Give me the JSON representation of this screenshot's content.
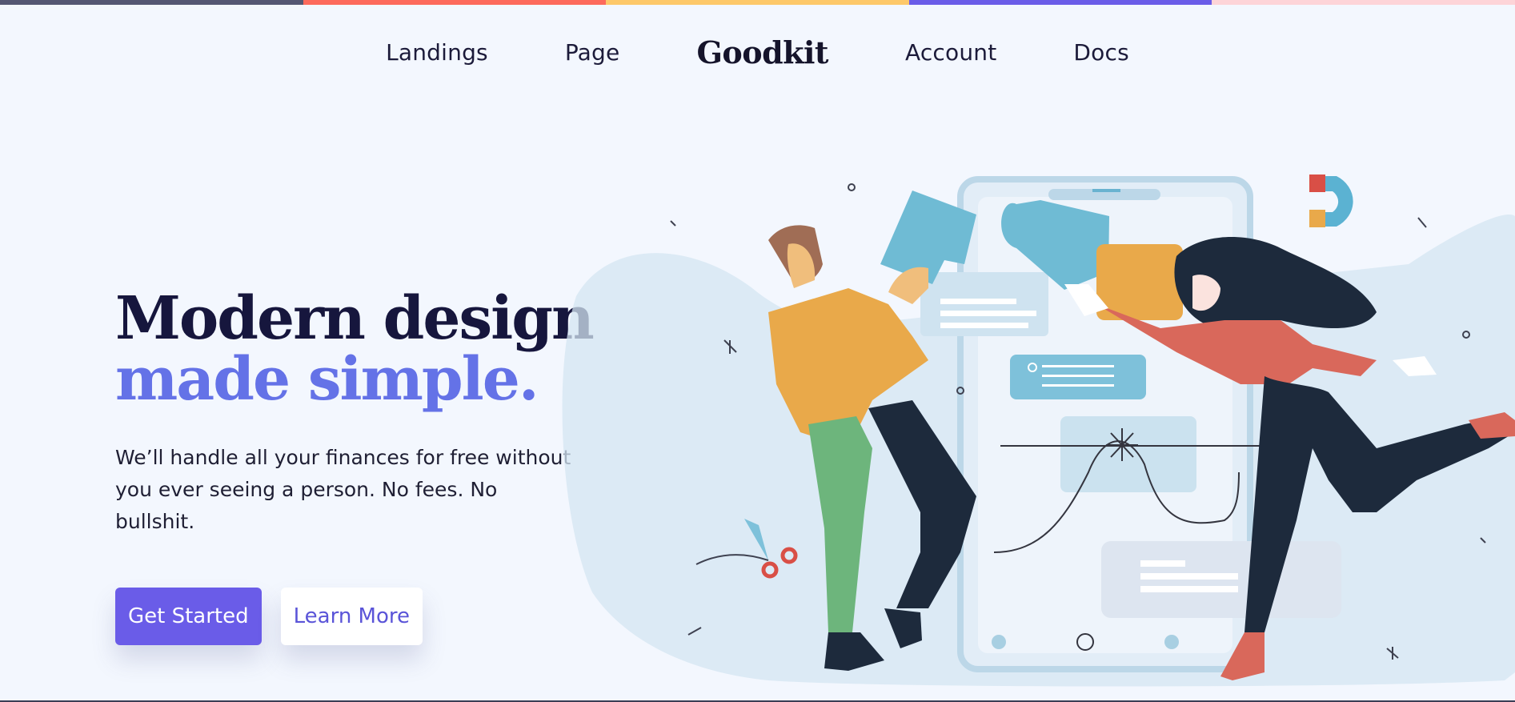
{
  "topbar": {
    "colors": [
      "#545773",
      "#fd6a5c",
      "#fdc86a",
      "#6a5ce8",
      "#fdd4d8"
    ]
  },
  "nav": {
    "links": [
      "Landings",
      "Page",
      "Account",
      "Docs"
    ],
    "brand": "Goodkit"
  },
  "hero": {
    "title_line1": "Modern design",
    "title_line2": "made simple.",
    "subtitle": "We’ll handle all your finances for free without you ever seeing a person. No fees. No bullshit.",
    "primary_button": "Get Started",
    "secondary_button": "Learn More"
  },
  "colors": {
    "accent": "#6a5ce8",
    "title_dark": "#16163d",
    "title_blue": "#6472e7",
    "background": "#f3f7fe"
  }
}
